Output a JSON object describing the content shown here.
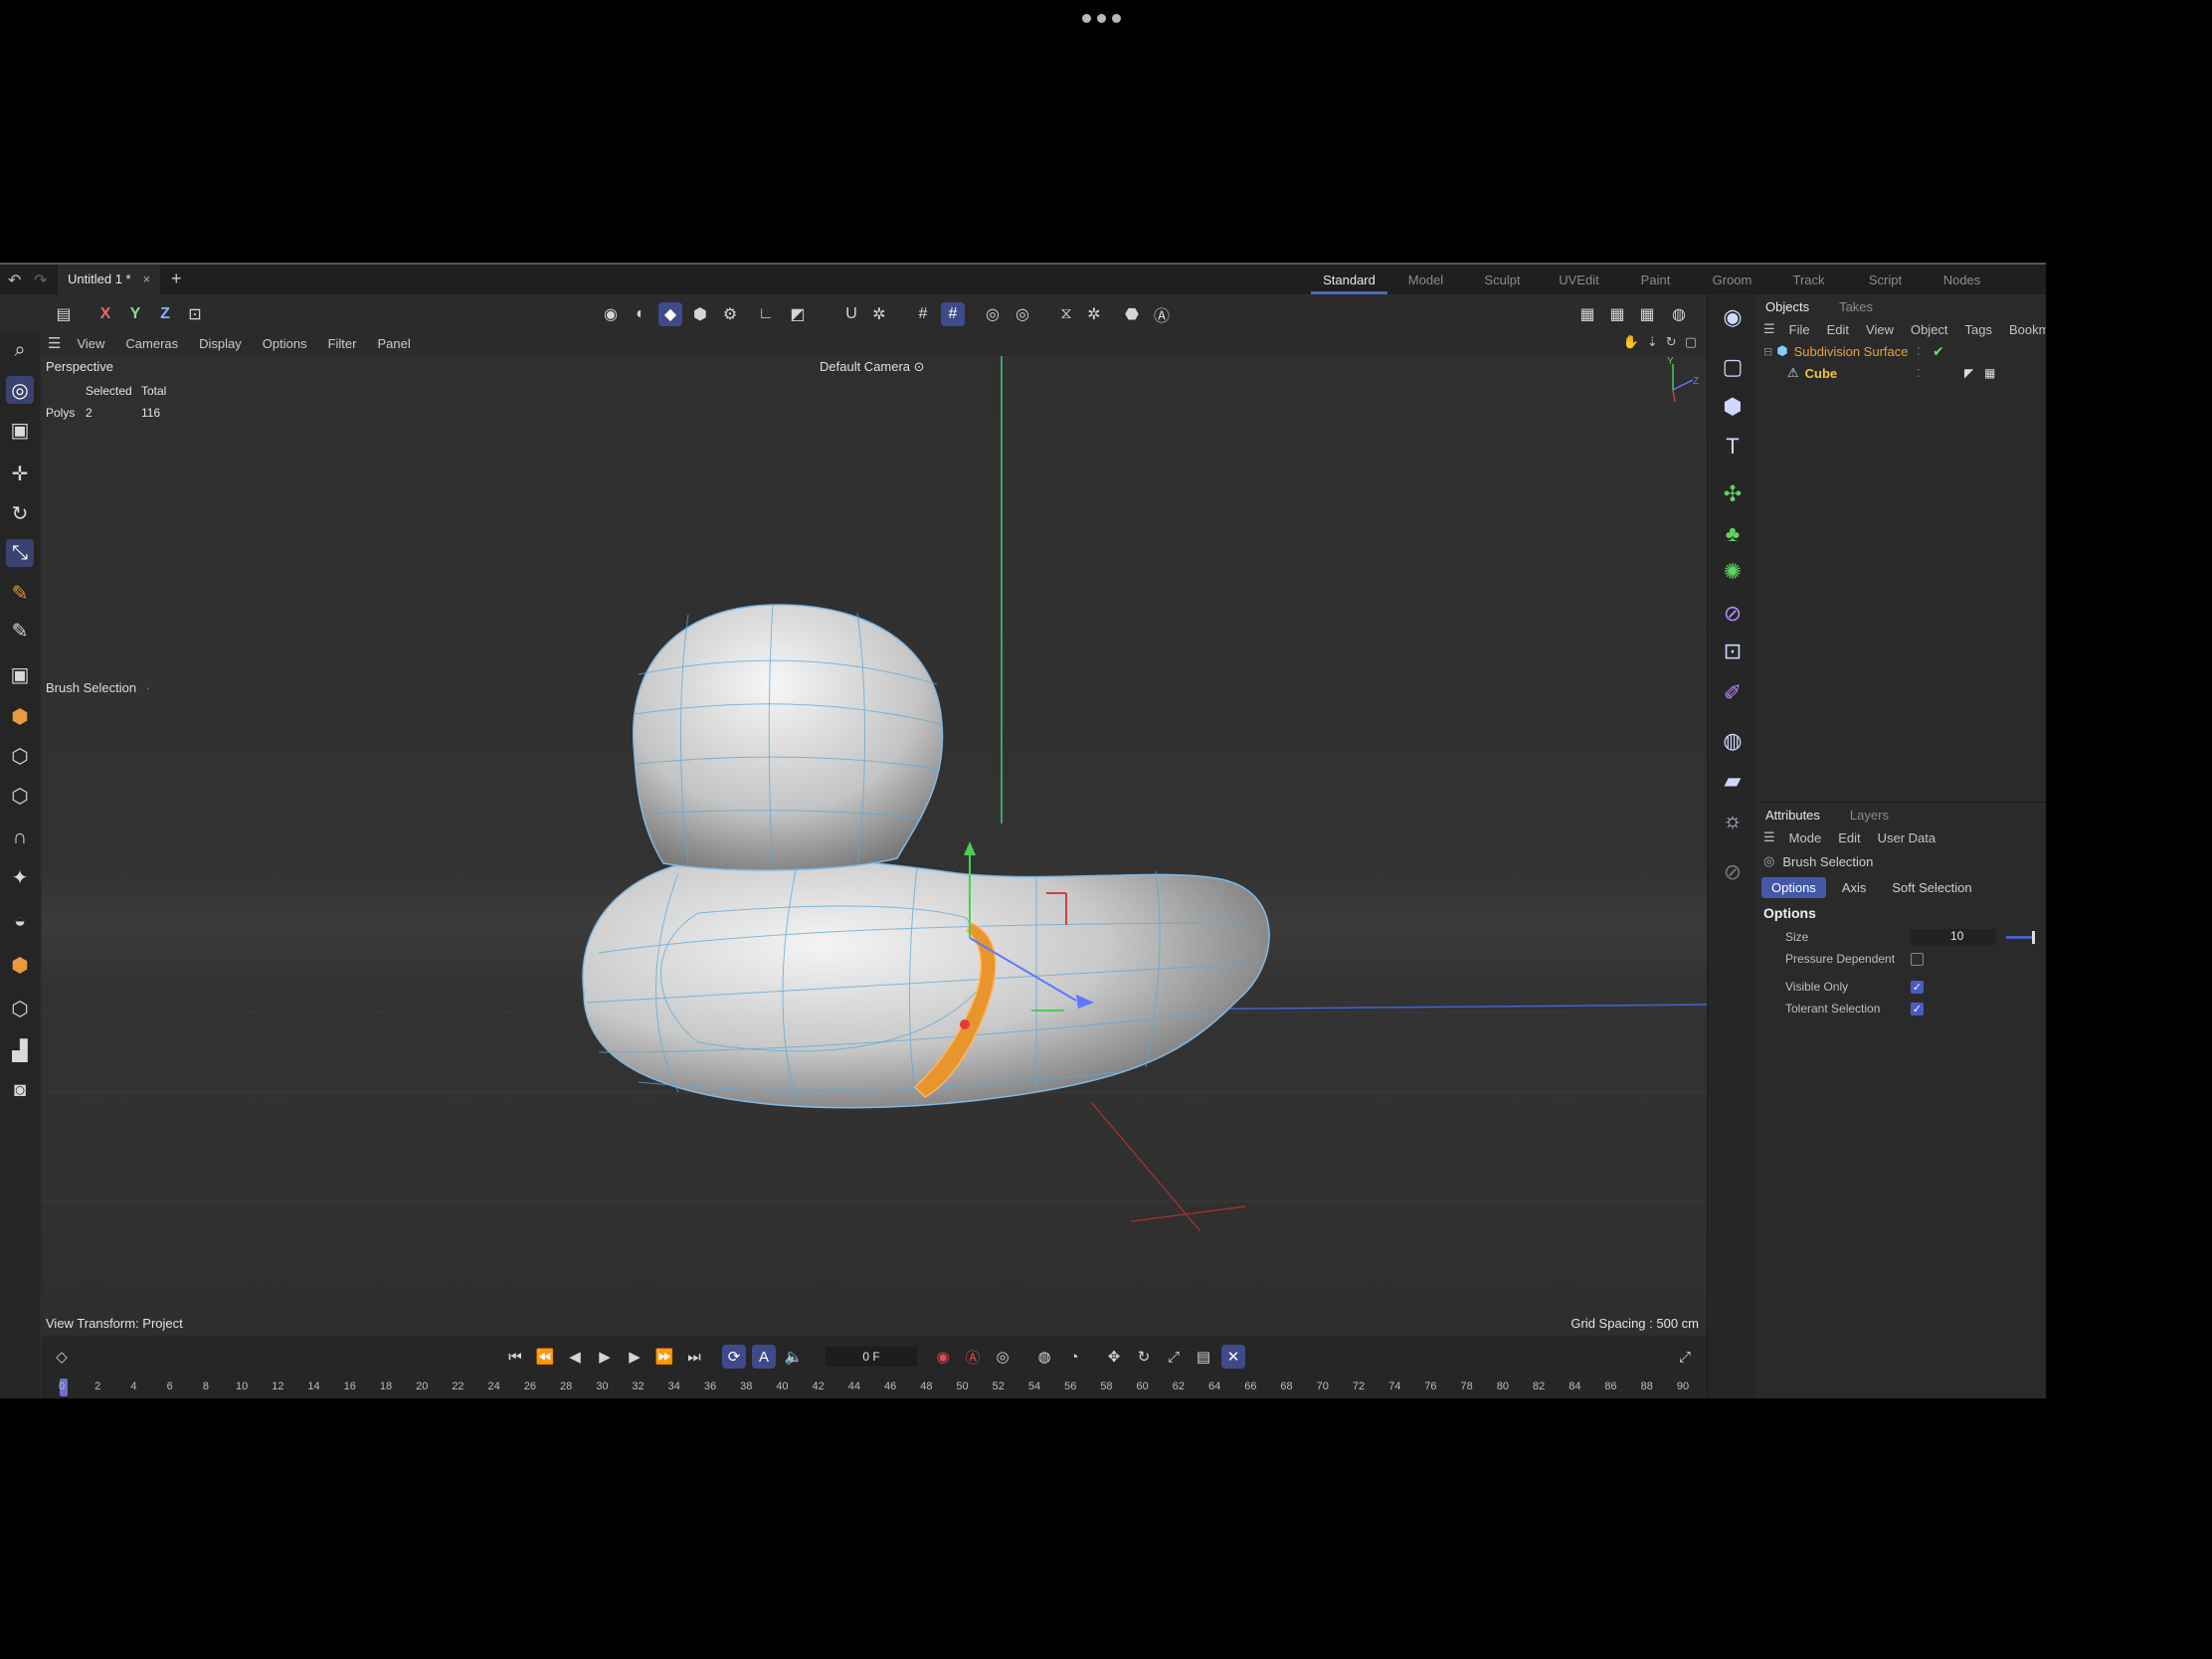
{
  "window": {
    "document_tab": "Untitled 1 *",
    "close_glyph": "×",
    "add_glyph": "+",
    "undo_glyph": "↶",
    "redo_glyph": "↷"
  },
  "layouts": [
    "Standard",
    "Model",
    "Sculpt",
    "UVEdit",
    "Paint",
    "Groom",
    "Track",
    "Script",
    "Nodes"
  ],
  "active_layout": "Standard",
  "toolbar_axes": [
    "X",
    "Y",
    "Z"
  ],
  "viewport_menu": [
    "View",
    "Cameras",
    "Display",
    "Options",
    "Filter",
    "Panel"
  ],
  "viewport": {
    "title": "Perspective",
    "camera": "Default Camera",
    "camera_suffix": "⊙",
    "stats": {
      "header_selected": "Selected",
      "header_total": "Total",
      "row_label": "Polys",
      "selected": "2",
      "total": "116"
    },
    "tool_label": "Brush Selection",
    "tool_label_suffix": "·",
    "view_transform": "View Transform: Project",
    "grid_spacing": "Grid Spacing : 500 cm",
    "axis_gizmo_y": "Y",
    "axis_gizmo_z": "Z"
  },
  "objects_panel": {
    "tabs": [
      "Objects",
      "Takes"
    ],
    "menu": [
      "File",
      "Edit",
      "View",
      "Object",
      "Tags",
      "Bookmar"
    ],
    "items": [
      {
        "name": "Subdivision Surface",
        "icon": "subdivision-icon"
      },
      {
        "name": "Cube",
        "icon": "polygon-object-icon"
      }
    ]
  },
  "attributes_panel": {
    "tabs": [
      "Attributes",
      "Layers"
    ],
    "menu": [
      "Mode",
      "Edit",
      "User Data"
    ],
    "tool_name": "Brush Selection",
    "subtabs": [
      "Options",
      "Axis",
      "Soft Selection"
    ],
    "active_subtab": "Options",
    "section": "Options",
    "fields": {
      "size_label": "Size",
      "size_value": "10",
      "size_fraction": 0.1,
      "pressure_label": "Pressure Dependent",
      "pressure_checked": false,
      "visible_only_label": "Visible Only",
      "visible_only_checked": true,
      "tolerant_label": "Tolerant Selection",
      "tolerant_checked": true
    }
  },
  "timeline": {
    "current_frame": "0 F",
    "ticks": [
      "0",
      "2",
      "4",
      "6",
      "8",
      "10",
      "12",
      "14",
      "16",
      "18",
      "20",
      "22",
      "24",
      "26",
      "28",
      "30",
      "32",
      "34",
      "36",
      "38",
      "40",
      "42",
      "44",
      "46",
      "48",
      "50",
      "52",
      "54",
      "56",
      "58",
      "60",
      "62",
      "64",
      "66",
      "68",
      "70",
      "72",
      "74",
      "76",
      "78",
      "80",
      "82",
      "84",
      "86",
      "88",
      "90"
    ]
  },
  "colors": {
    "accent": "#4359a8",
    "selection_orange": "#e8952e",
    "wire": "#5aa8d8",
    "object_name_parent": "#e8a23c",
    "object_name_child": "#f0c340"
  }
}
